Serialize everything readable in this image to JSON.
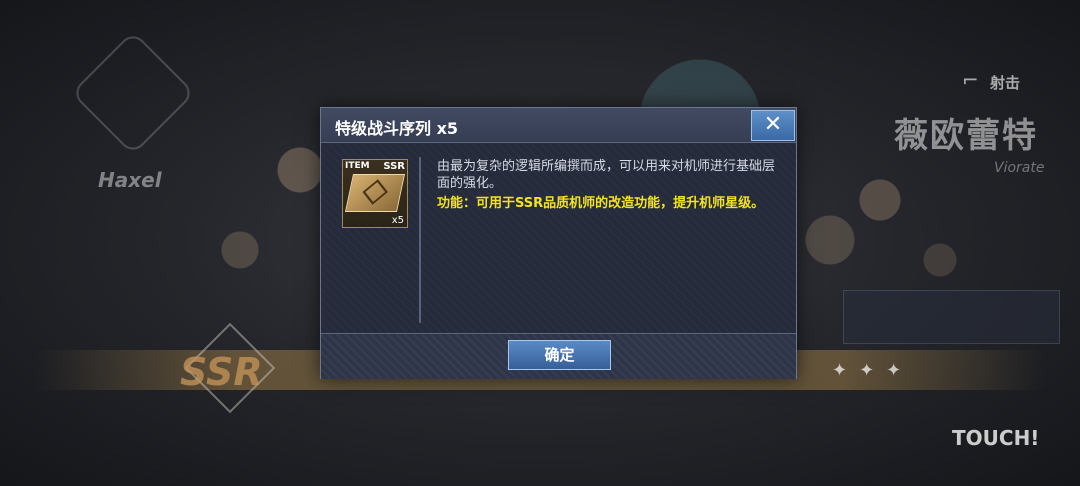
{
  "background": {
    "left_name": "Haxel",
    "right_role": "射击",
    "right_name": "薇欧蕾特",
    "right_name_en": "Viorate",
    "rarity": "SSR",
    "touch_hint": "TOUCH!"
  },
  "dialog": {
    "title": "特级战斗序列 x5",
    "close_label": "✕",
    "item": {
      "tag": "ITEM",
      "rarity": "SSR",
      "quantity": "x5"
    },
    "description": "由最为复杂的逻辑所编撰而成，可以用来对机师进行基础层面的强化。",
    "function_text": "功能：可用于SSR品质机师的改造功能，提升机师星级。",
    "confirm_label": "确定"
  },
  "colors": {
    "function_text": "#f2e31c",
    "button": "#4a7bb8",
    "panel": "#2b3143"
  }
}
